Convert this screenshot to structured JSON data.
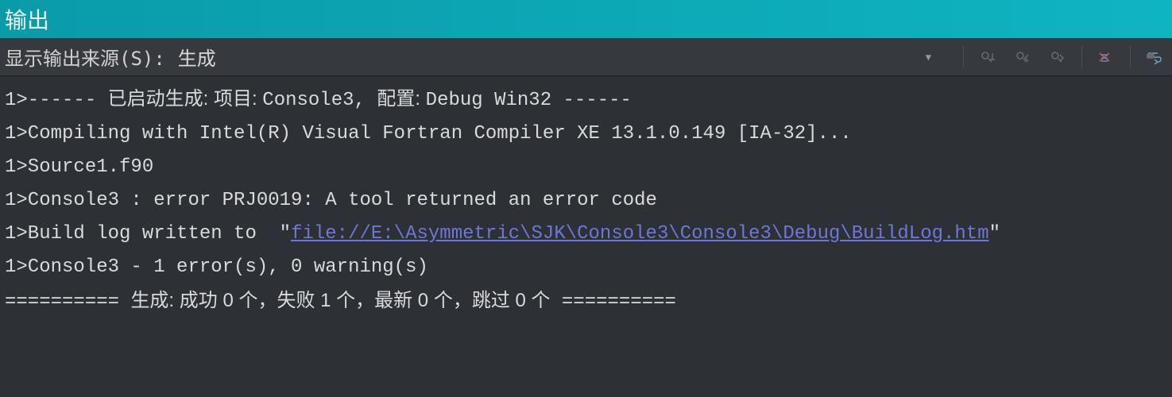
{
  "title_bar": {
    "title": "输出"
  },
  "toolbar": {
    "source_label": "显示输出来源(S):",
    "dropdown_value": "生成",
    "icons": {
      "arrow": "dropdown-arrow",
      "btn1": "find-message-icon",
      "btn2": "prev-message-icon",
      "btn3": "next-message-icon",
      "btn4": "clear-all-icon",
      "btn5": "word-wrap-icon"
    }
  },
  "output": {
    "line1_prefix": "1>------ ",
    "line1_cjk": "已启动生成: 项目: ",
    "line1_mid": "Console3, ",
    "line1_cjk2": "配置: ",
    "line1_suffix": "Debug Win32 ------",
    "line2": "1>Compiling with Intel(R) Visual Fortran Compiler XE 13.1.0.149 [IA-32]...",
    "line3": "1>Source1.f90",
    "line4": "1>Console3 : error PRJ0019: A tool returned an error code",
    "line5_prefix": "1>Build log written to  ",
    "line5_quote_open": "\"",
    "line5_link": "file://E:\\Asymmetric\\SJK\\Console3\\Console3\\Debug\\BuildLog.htm",
    "line5_quote_close": "\"",
    "line6": "1>Console3 - 1 error(s), 0 warning(s)",
    "line7_prefix": "========== ",
    "line7_cjk": "生成: 成功 0 个，失败 1 个，最新 0 个，跳过 0 个",
    "line7_suffix": " =========="
  }
}
